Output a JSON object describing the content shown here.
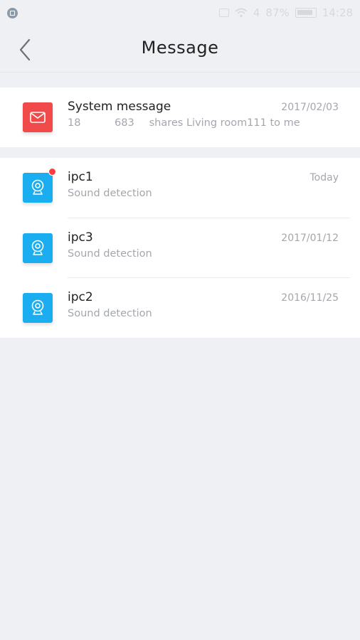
{
  "status_bar": {
    "signal_text": "4",
    "battery_percent": "87%",
    "time": "14:28",
    "battery_level": 0.87
  },
  "header": {
    "title": "Message"
  },
  "system_message": {
    "name": "System message",
    "date": "2017/02/03",
    "detail": {
      "part1": "18",
      "part2": "683",
      "part3": "shares Living room111 to me"
    },
    "icon": "envelope-icon",
    "color": "#f04a4a"
  },
  "devices": [
    {
      "name": "ipc1",
      "subtitle": "Sound detection",
      "date": "Today",
      "unread": true,
      "icon": "camera-icon"
    },
    {
      "name": "ipc3",
      "subtitle": "Sound detection",
      "date": "2017/01/12",
      "unread": false,
      "icon": "camera-icon"
    },
    {
      "name": "ipc2",
      "subtitle": "Sound detection",
      "date": "2016/11/25",
      "unread": false,
      "icon": "camera-icon"
    }
  ],
  "colors": {
    "accent_blue": "#1aaef0",
    "accent_red": "#f04a4a",
    "background": "#eef0f4",
    "unread_dot": "#ff3b3b"
  }
}
